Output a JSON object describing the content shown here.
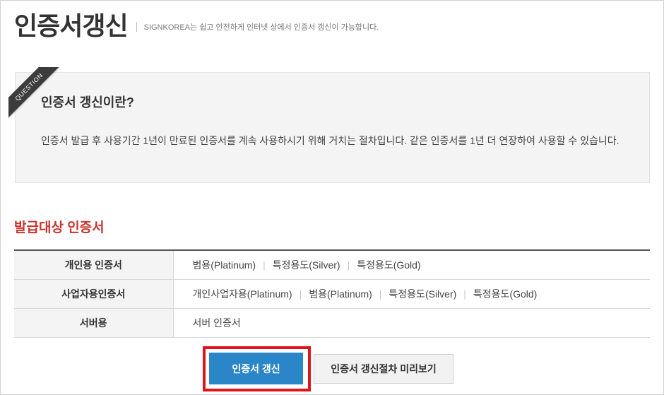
{
  "header": {
    "title": "인증서갱신",
    "subtitle": "SIGNKOREA는 쉽고 안전하게 인터넷 상에서 인증서 갱신이 가능합니다."
  },
  "question": {
    "ribbon_label": "QUESTION",
    "title": "인증서 갱신이란?",
    "body": "인증서 발급 후 사용기간 1년이 만료된 인증서를 계속 사용하시기 위해 거치는 절차입니다. 같은 인증서를 1년 더 연장하여 사용할 수 있습니다."
  },
  "section": {
    "title": "발급대상 인증서"
  },
  "table": {
    "rows": [
      {
        "label": "개인용 인증서",
        "items": [
          "범용(Platinum)",
          "특정용도(Silver)",
          "특정용도(Gold)"
        ]
      },
      {
        "label": "사업자용인증서",
        "items": [
          "개인사업자용(Platinum)",
          "범용(Platinum)",
          "특정용도(Silver)",
          "특정용도(Gold)"
        ]
      },
      {
        "label": "서버용",
        "items": [
          "서버 인증서"
        ]
      }
    ]
  },
  "buttons": {
    "renew": "인증서 갱신",
    "preview": "인증서 갱신절차 미리보기"
  },
  "colors": {
    "accent_red": "#c9342e",
    "highlight_red": "#e0141a",
    "primary_blue": "#2a86c8"
  }
}
